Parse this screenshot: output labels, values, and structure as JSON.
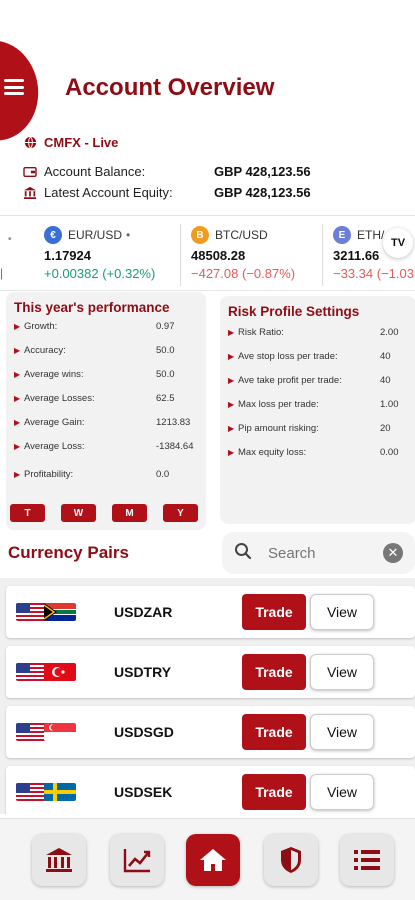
{
  "header": {
    "title": "Account Overview",
    "menu_icon": "hamburger-icon"
  },
  "account": {
    "name": "CMFX - Live",
    "balance_label": "Account Balance:",
    "balance_value": "GBP 428,123.56",
    "equity_label": "Latest Account Equity:",
    "equity_value": "GBP 428,123.56"
  },
  "ticker": [
    {
      "symbol": "EUR/USD",
      "price": "1.17924",
      "change": "+0.00382 (+0.32%)",
      "direction": "up",
      "coin_color": "#3b6fd8",
      "coin": "€"
    },
    {
      "symbol": "BTC/USD",
      "price": "48508.28",
      "change": "−427.08 (−0.87%)",
      "direction": "down",
      "coin_color": "#f29c1f",
      "coin": "B"
    },
    {
      "symbol": "ETH/",
      "price": "3211.66",
      "change": "−33.34 (−1.03",
      "direction": "down",
      "coin_color": "#6b7fd8",
      "coin": "E"
    }
  ],
  "tv_badge": "TV",
  "performance": {
    "title": "This year's performance",
    "stats": [
      {
        "label": "Growth:",
        "value": "0.97"
      },
      {
        "label": "Accuracy:",
        "value": "50.0"
      },
      {
        "label": "Average wins:",
        "value": "50.0"
      },
      {
        "label": "Average Losses:",
        "value": "62.5"
      },
      {
        "label": "Average Gain:",
        "value": "1213.83"
      },
      {
        "label": "Average Loss:",
        "value": "-1384.64"
      },
      {
        "label": "Profitability:",
        "value": "0.0"
      }
    ],
    "periods": [
      "T",
      "W",
      "M",
      "Y"
    ]
  },
  "risk": {
    "title": "Risk Profile Settings",
    "stats": [
      {
        "label": "Risk Ratio:",
        "value": "2.00"
      },
      {
        "label": "Ave stop loss per trade:",
        "value": "40"
      },
      {
        "label": "Ave take profit per trade:",
        "value": "40"
      },
      {
        "label": "Max loss per trade:",
        "value": "1.00"
      },
      {
        "label": "Pip amount risking:",
        "value": "20"
      },
      {
        "label": "Max equity loss:",
        "value": "0.00"
      }
    ]
  },
  "pairs_section": {
    "title": "Currency Pairs"
  },
  "search": {
    "placeholder": "Search"
  },
  "pairs": [
    {
      "name": "USDZAR",
      "trade_label": "Trade",
      "view_label": "View"
    },
    {
      "name": "USDTRY",
      "trade_label": "Trade",
      "view_label": "View"
    },
    {
      "name": "USDSGD",
      "trade_label": "Trade",
      "view_label": "View"
    },
    {
      "name": "USDSEK",
      "trade_label": "Trade",
      "view_label": "View"
    }
  ],
  "nav": [
    {
      "name": "bank-icon",
      "active": false
    },
    {
      "name": "chart-icon",
      "active": false
    },
    {
      "name": "home-icon",
      "active": true
    },
    {
      "name": "shield-icon",
      "active": false
    },
    {
      "name": "list-icon",
      "active": false
    }
  ],
  "colors": {
    "brand": "#b01018",
    "brand_dark": "#8e0c14",
    "up": "#1a9c73",
    "down": "#e35a5a"
  }
}
